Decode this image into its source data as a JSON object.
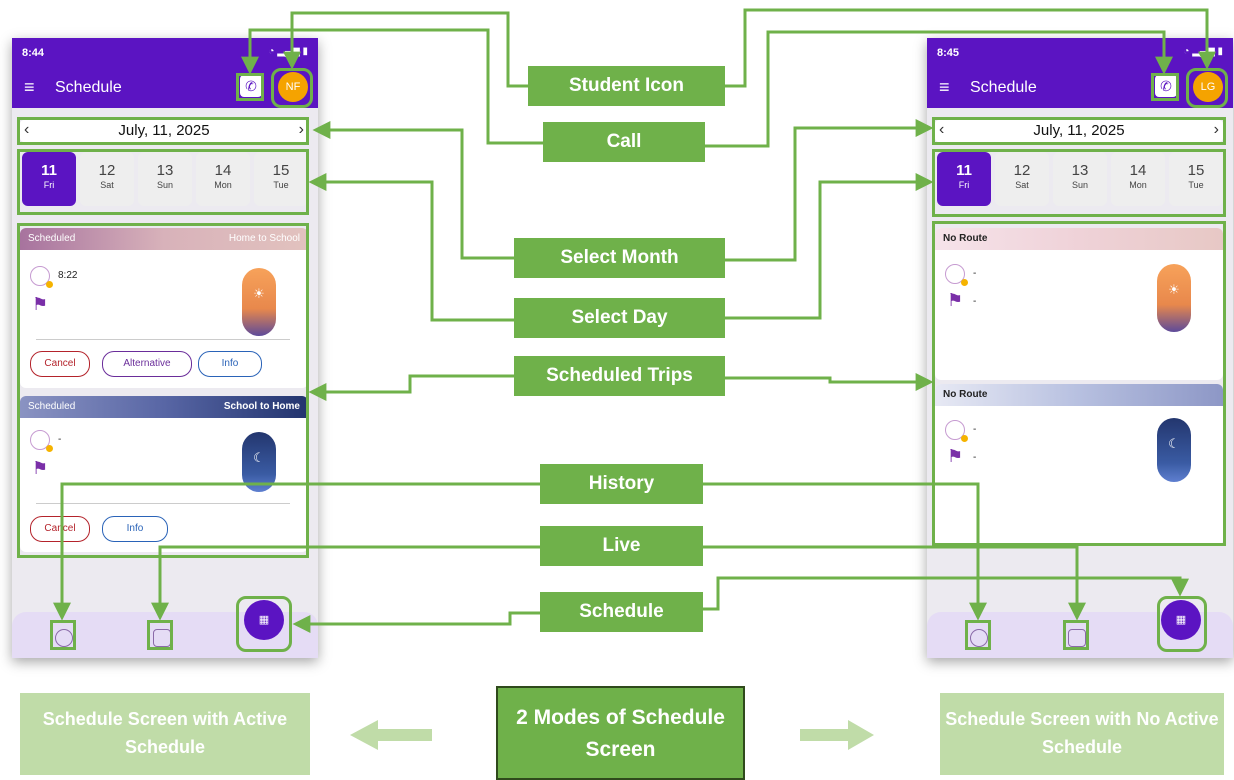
{
  "left_phone": {
    "status_time": "8:44",
    "app_title": "Schedule",
    "avatar_initials": "NF",
    "month_label": "July, 11, 2025",
    "days": [
      {
        "num": "11",
        "dow": "Fri"
      },
      {
        "num": "12",
        "dow": "Sat"
      },
      {
        "num": "13",
        "dow": "Sun"
      },
      {
        "num": "14",
        "dow": "Mon"
      },
      {
        "num": "15",
        "dow": "Tue"
      }
    ],
    "card1": {
      "status": "Scheduled",
      "route": "Home to School",
      "time": "8:22",
      "btn_cancel": "Cancel",
      "btn_alt": "Alternative",
      "btn_info": "Info"
    },
    "card2": {
      "status": "Scheduled",
      "route": "School to Home",
      "time": "-",
      "btn_cancel": "Cancel",
      "btn_info": "Info"
    }
  },
  "right_phone": {
    "status_time": "8:45",
    "app_title": "Schedule",
    "avatar_initials": "LG",
    "month_label": "July, 11, 2025",
    "days": [
      {
        "num": "11",
        "dow": "Fri"
      },
      {
        "num": "12",
        "dow": "Sat"
      },
      {
        "num": "13",
        "dow": "Sun"
      },
      {
        "num": "14",
        "dow": "Mon"
      },
      {
        "num": "15",
        "dow": "Tue"
      }
    ],
    "card1": {
      "status": "No Route",
      "time": "-",
      "place": "-"
    },
    "card2": {
      "status": "No Route",
      "time": "-",
      "place": "-"
    }
  },
  "labels": {
    "student_icon": "Student Icon",
    "call": "Call",
    "select_month": "Select Month",
    "select_day": "Select Day",
    "scheduled_trips": "Scheduled Trips",
    "history": "History",
    "live": "Live",
    "schedule": "Schedule"
  },
  "footer": {
    "left": "Schedule Screen with Active Schedule",
    "center": "2 Modes of Schedule Screen",
    "right": "Schedule Screen with No Active Schedule"
  },
  "colors": {
    "accent_green": "#6fb14a",
    "app_purple": "#5b14c2",
    "avatar_orange": "#f5a300"
  }
}
